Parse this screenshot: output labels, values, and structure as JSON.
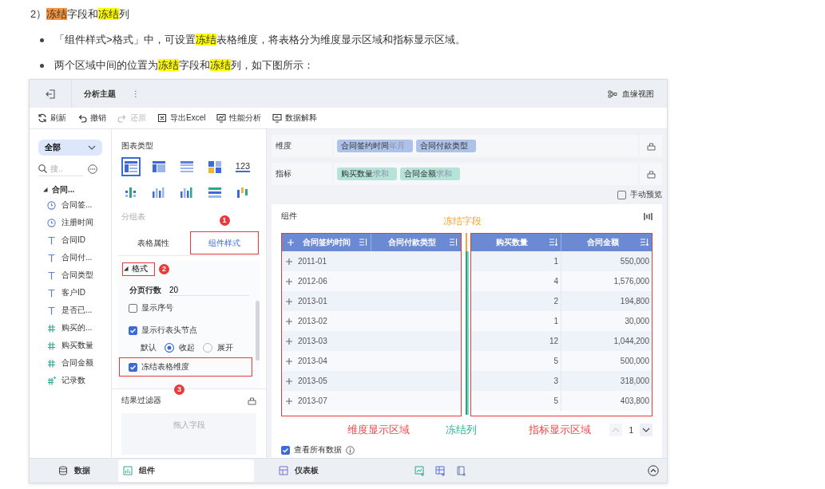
{
  "heading": [
    {
      "text": "2）"
    },
    {
      "text": "冻结",
      "color": "#f7953f"
    },
    {
      "text": "字段和"
    },
    {
      "text": "冻结",
      "color": "#ffff00"
    },
    {
      "text": "列"
    }
  ],
  "bullets": [
    [
      {
        "text": "「组件样式>格式」中，可设置"
      },
      {
        "text": "冻结",
        "color": "#ffff00"
      },
      {
        "text": "表格维度，将表格分为维度显示区域和指标显示区域。"
      }
    ],
    [
      {
        "text": "两个区域中间的位置为"
      },
      {
        "text": "冻结",
        "color": "#ffff00"
      },
      {
        "text": "字段和"
      },
      {
        "text": "冻结",
        "color": "#ffff00"
      },
      {
        "text": "列，如下图所示："
      }
    ]
  ],
  "app": {
    "title": "分析主题",
    "more": "⋮",
    "lineage": "血缘视图",
    "toolbar": [
      {
        "label": "刷新",
        "disabled": false
      },
      {
        "label": "撤销",
        "disabled": false
      },
      {
        "label": "还原",
        "disabled": true
      },
      {
        "label": "导出Excel",
        "disabled": false
      },
      {
        "label": "性能分析",
        "disabled": false
      },
      {
        "label": "数据解释",
        "disabled": false
      }
    ],
    "data_panel": {
      "scope": "全部",
      "search_placeholder": "搜..",
      "tree": [
        {
          "label": "合同...",
          "expanded": true,
          "children": [
            {
              "label": "合同签...",
              "kind": "date"
            },
            {
              "label": "注册时间",
              "kind": "date"
            },
            {
              "label": "合同ID",
              "kind": "text"
            },
            {
              "label": "合同付...",
              "kind": "text"
            },
            {
              "label": "合同类型",
              "kind": "text"
            },
            {
              "label": "客户ID",
              "kind": "text"
            },
            {
              "label": "是否已...",
              "kind": "text"
            },
            {
              "label": "购买的...",
              "kind": "number"
            },
            {
              "label": "购买数量",
              "kind": "number"
            },
            {
              "label": "合同金额",
              "kind": "number"
            },
            {
              "label": "记录数",
              "kind": "count"
            }
          ]
        }
      ]
    },
    "style_panel": {
      "chart_type_label": "图表类型",
      "chart_types": [
        {
          "selected": true
        },
        {
          "selected": false
        },
        {
          "selected": false
        },
        {
          "selected": false
        },
        {
          "selected": false,
          "label": "123"
        },
        {
          "selected": false
        },
        {
          "selected": false
        },
        {
          "selected": false
        },
        {
          "selected": false
        },
        {
          "selected": false
        }
      ],
      "chart_name": "分组表",
      "tabs": [
        {
          "label": "表格属性",
          "selected": false
        },
        {
          "label": "组件样式",
          "selected": true,
          "callout": "1"
        }
      ],
      "section": {
        "label": "格式",
        "expanded": true,
        "callout": "2"
      },
      "page_rows": {
        "label": "分页行数",
        "value": "20"
      },
      "options": [
        {
          "kind": "checkbox",
          "label": "显示序号",
          "checked": false
        },
        {
          "kind": "checkbox",
          "label": "显示行表头节点",
          "checked": true
        },
        {
          "kind": "radio",
          "label": "默认",
          "choices": [
            {
              "label": "收起",
              "selected": true
            },
            {
              "label": "展开",
              "selected": false
            }
          ]
        },
        {
          "kind": "checkbox",
          "label": "冻结表格维度",
          "checked": true,
          "callout": "3"
        }
      ],
      "filter": {
        "label": "结果过滤器",
        "placeholder": "拖入字段"
      }
    },
    "analysis": {
      "dimension": {
        "label": "维度",
        "fields": [
          {
            "name": "合同签约时间",
            "detail": "年月"
          },
          {
            "name": "合同付款类型"
          }
        ]
      },
      "measure": {
        "label": "指标",
        "fields": [
          {
            "name": "购买数量",
            "detail": "求和"
          },
          {
            "name": "合同金额",
            "detail": "求和"
          }
        ]
      },
      "manual_preview": {
        "label": "手动预览",
        "checked": false
      },
      "component": {
        "title": "组件",
        "freeze_field_note": "冻结字段",
        "dimension_columns": [
          "合同签约时间",
          "合同付款类型"
        ],
        "measure_columns": [
          "购买数量",
          "合同金额"
        ],
        "rows": [
          {
            "date": "2011-01",
            "quantity": "1",
            "amount": "550,000"
          },
          {
            "date": "2012-06",
            "quantity": "4",
            "amount": "1,576,000"
          },
          {
            "date": "2013-01",
            "quantity": "2",
            "amount": "194,800"
          },
          {
            "date": "2013-02",
            "quantity": "1",
            "amount": "30,000"
          },
          {
            "date": "2013-03",
            "quantity": "12",
            "amount": "1,044,200"
          },
          {
            "date": "2013-04",
            "quantity": "5",
            "amount": "500,000"
          },
          {
            "date": "2013-05",
            "quantity": "3",
            "amount": "318,000"
          },
          {
            "date": "2013-07",
            "quantity": "5",
            "amount": "403,800"
          }
        ],
        "dimension_note": "维度显示区域",
        "freeze_note": "冻结列",
        "measure_note": "指标显示区域",
        "pager": {
          "page": "1",
          "previous_disabled": true
        },
        "show_all": {
          "label": "查看所有数据",
          "checked": true
        }
      }
    },
    "bottom_tabs": [
      {
        "label": "数据",
        "selected": false
      },
      {
        "label": "组件",
        "selected": true
      },
      {
        "label": "仪表板",
        "selected": false
      }
    ]
  }
}
